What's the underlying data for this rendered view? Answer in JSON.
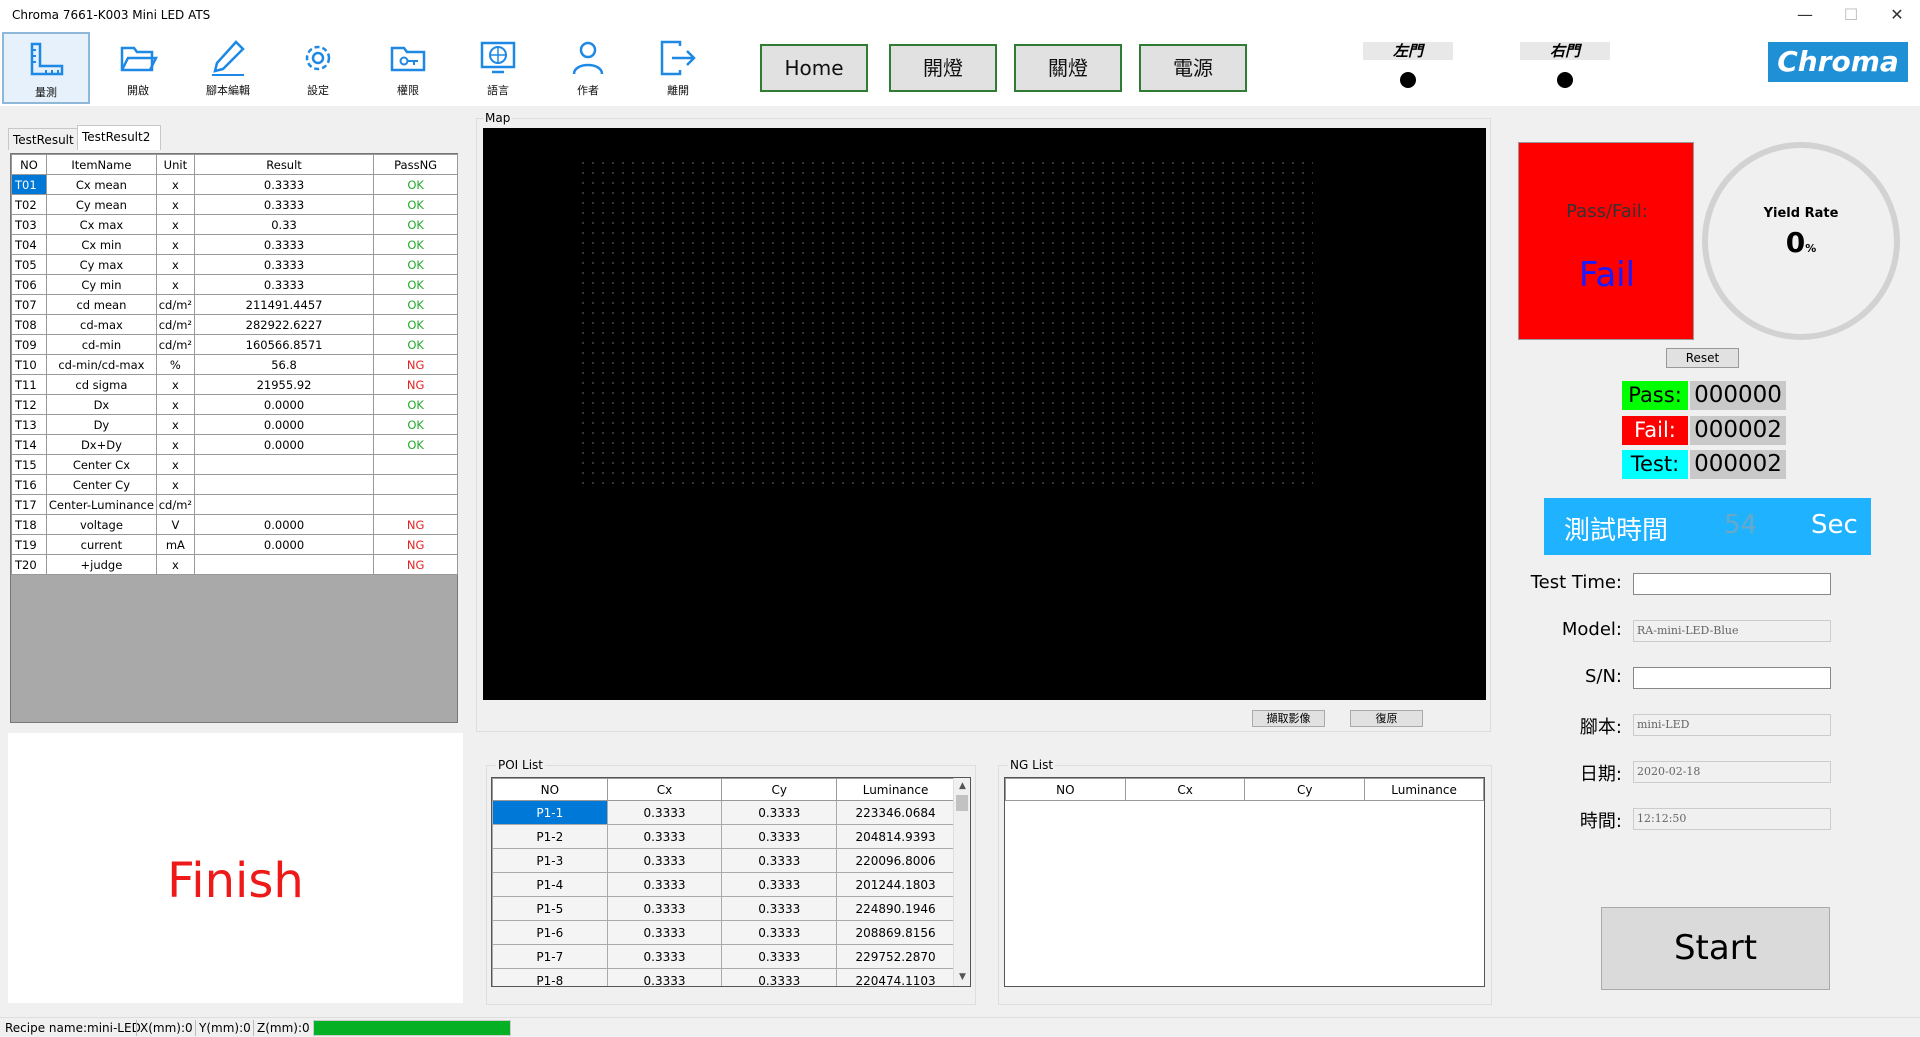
{
  "window": {
    "title": "Chroma 7661-K003 Mini LED ATS",
    "minimize": "—",
    "maximize": "☐",
    "close": "✕"
  },
  "toolbar": {
    "tools": [
      {
        "label": "量測",
        "icon": "ruler-icon"
      },
      {
        "label": "開啟",
        "icon": "folder-open-icon"
      },
      {
        "label": "腳本編輯",
        "icon": "pen-icon"
      },
      {
        "label": "設定",
        "icon": "gear-icon"
      },
      {
        "label": "權限",
        "icon": "key-folder-icon"
      },
      {
        "label": "語言",
        "icon": "globe-icon"
      },
      {
        "label": "作者",
        "icon": "person-icon"
      },
      {
        "label": "離開",
        "icon": "exit-icon"
      }
    ],
    "nav": [
      "Home",
      "開燈",
      "關燈",
      "電源"
    ],
    "doors": [
      "左門",
      "右門"
    ],
    "logo": "Chroma"
  },
  "result_tabs": [
    "TestResult",
    "TestResult2"
  ],
  "result_table": {
    "headers": [
      "NO",
      "ItemName",
      "Unit",
      "Result",
      "PassNG"
    ],
    "rows": [
      {
        "no": "T01",
        "item": "Cx mean",
        "unit": "x",
        "result": "0.3333",
        "pass": "OK"
      },
      {
        "no": "T02",
        "item": "Cy mean",
        "unit": "x",
        "result": "0.3333",
        "pass": "OK"
      },
      {
        "no": "T03",
        "item": "Cx max",
        "unit": "x",
        "result": "0.33",
        "pass": "OK"
      },
      {
        "no": "T04",
        "item": "Cx min",
        "unit": "x",
        "result": "0.3333",
        "pass": "OK"
      },
      {
        "no": "T05",
        "item": "Cy max",
        "unit": "x",
        "result": "0.3333",
        "pass": "OK"
      },
      {
        "no": "T06",
        "item": "Cy min",
        "unit": "x",
        "result": "0.3333",
        "pass": "OK"
      },
      {
        "no": "T07",
        "item": "cd mean",
        "unit": "cd/m²",
        "result": "211491.4457",
        "pass": "OK"
      },
      {
        "no": "T08",
        "item": "cd-max",
        "unit": "cd/m²",
        "result": "282922.6227",
        "pass": "OK"
      },
      {
        "no": "T09",
        "item": "cd-min",
        "unit": "cd/m²",
        "result": "160566.8571",
        "pass": "OK"
      },
      {
        "no": "T10",
        "item": "cd-min/cd-max",
        "unit": "%",
        "result": "56.8",
        "pass": "NG"
      },
      {
        "no": "T11",
        "item": "cd sigma",
        "unit": "x",
        "result": "21955.92",
        "pass": "NG"
      },
      {
        "no": "T12",
        "item": "Dx",
        "unit": "x",
        "result": "0.0000",
        "pass": "OK"
      },
      {
        "no": "T13",
        "item": "Dy",
        "unit": "x",
        "result": "0.0000",
        "pass": "OK"
      },
      {
        "no": "T14",
        "item": "Dx+Dy",
        "unit": "x",
        "result": "0.0000",
        "pass": "OK"
      },
      {
        "no": "T15",
        "item": "Center Cx",
        "unit": "x",
        "result": "",
        "pass": ""
      },
      {
        "no": "T16",
        "item": "Center Cy",
        "unit": "x",
        "result": "",
        "pass": ""
      },
      {
        "no": "T17",
        "item": "Center-Luminance",
        "unit": "cd/m²",
        "result": "",
        "pass": ""
      },
      {
        "no": "T18",
        "item": "voltage",
        "unit": "V",
        "result": "0.0000",
        "pass": "NG"
      },
      {
        "no": "T19",
        "item": "current",
        "unit": "mA",
        "result": "0.0000",
        "pass": "NG"
      },
      {
        "no": "T20",
        "item": "+judge",
        "unit": "x",
        "result": "",
        "pass": "NG"
      }
    ]
  },
  "finish_text": "Finish",
  "map": {
    "caption": "Map",
    "capture_button": "擷取影像",
    "restore_button": "復原"
  },
  "poi": {
    "caption": "POI List",
    "headers": [
      "NO",
      "Cx",
      "Cy",
      "Luminance"
    ],
    "rows": [
      {
        "no": "P1-1",
        "cx": "0.3333",
        "cy": "0.3333",
        "lum": "223346.0684"
      },
      {
        "no": "P1-2",
        "cx": "0.3333",
        "cy": "0.3333",
        "lum": "204814.9393"
      },
      {
        "no": "P1-3",
        "cx": "0.3333",
        "cy": "0.3333",
        "lum": "220096.8006"
      },
      {
        "no": "P1-4",
        "cx": "0.3333",
        "cy": "0.3333",
        "lum": "201244.1803"
      },
      {
        "no": "P1-5",
        "cx": "0.3333",
        "cy": "0.3333",
        "lum": "224890.1946"
      },
      {
        "no": "P1-6",
        "cx": "0.3333",
        "cy": "0.3333",
        "lum": "208869.8156"
      },
      {
        "no": "P1-7",
        "cx": "0.3333",
        "cy": "0.3333",
        "lum": "229752.2870"
      },
      {
        "no": "P1-8",
        "cx": "0.3333",
        "cy": "0.3333",
        "lum": "220474.1103"
      }
    ]
  },
  "ng": {
    "caption": "NG List",
    "headers": [
      "NO",
      "Cx",
      "Cy",
      "Luminance"
    ]
  },
  "status": {
    "pass_fail_label": "Pass/Fail:",
    "pass_fail_value": "Fail",
    "yield_label": "Yield Rate",
    "yield_value": "0",
    "yield_unit": "%",
    "reset_button": "Reset",
    "pass_label": "Pass:",
    "pass_count": "000000",
    "fail_label": "Fail:",
    "fail_count": "000002",
    "test_label": "Test:",
    "test_count": "000002",
    "timer_label": "測試時間",
    "timer_value": "54",
    "timer_unit": "Sec"
  },
  "fields": {
    "test_time_label": "Test Time:",
    "test_time_value": "",
    "model_label": "Model:",
    "model_value": "RA-mini-LED-Blue",
    "sn_label": "S/N:",
    "sn_value": "",
    "script_label": "腳本:",
    "script_value": "mini-LED",
    "date_label": "日期:",
    "date_value": "2020-02-18",
    "time_label": "時間:",
    "time_value": "12:12:50"
  },
  "start_button": "Start",
  "statusbar": {
    "recipe": "Recipe name:mini-LED",
    "x": "X(mm):0",
    "y": "Y(mm):0",
    "z": "Z(mm):0",
    "progress": 1.0
  },
  "colors": {
    "pass_green": "#00ff00",
    "fail_red": "#ff0000",
    "test_cyan": "#00ffff",
    "timer_blue": "#1fb2ff",
    "ok": "#23a92a",
    "ng": "#e52222"
  }
}
